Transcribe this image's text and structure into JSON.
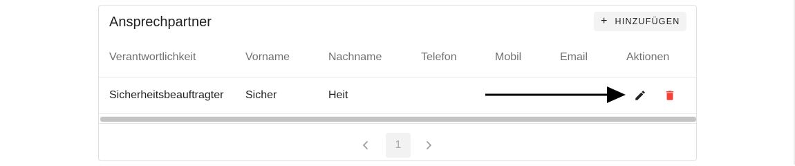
{
  "card": {
    "title": "Ansprechpartner",
    "add_button_label": "HINZUFÜGEN",
    "add_button_icon": "plus-icon"
  },
  "table": {
    "columns": [
      "Verantwortlichkeit",
      "Vorname",
      "Nachname",
      "Telefon",
      "Mobil",
      "Email",
      "Aktionen"
    ],
    "rows": [
      {
        "verantwortlichkeit": "Sicherheitsbeauftragter",
        "vorname": "Sicher",
        "nachname": "Heit",
        "telefon": "",
        "mobil": "",
        "email": "",
        "actions": [
          "edit-icon",
          "delete-icon"
        ]
      }
    ]
  },
  "pagination": {
    "current_page": "1",
    "prev_icon": "chevron-left-icon",
    "next_icon": "chevron-right-icon"
  },
  "colors": {
    "delete": "#f44336",
    "edit": "#212121",
    "annotation_arrow": "#000000"
  }
}
